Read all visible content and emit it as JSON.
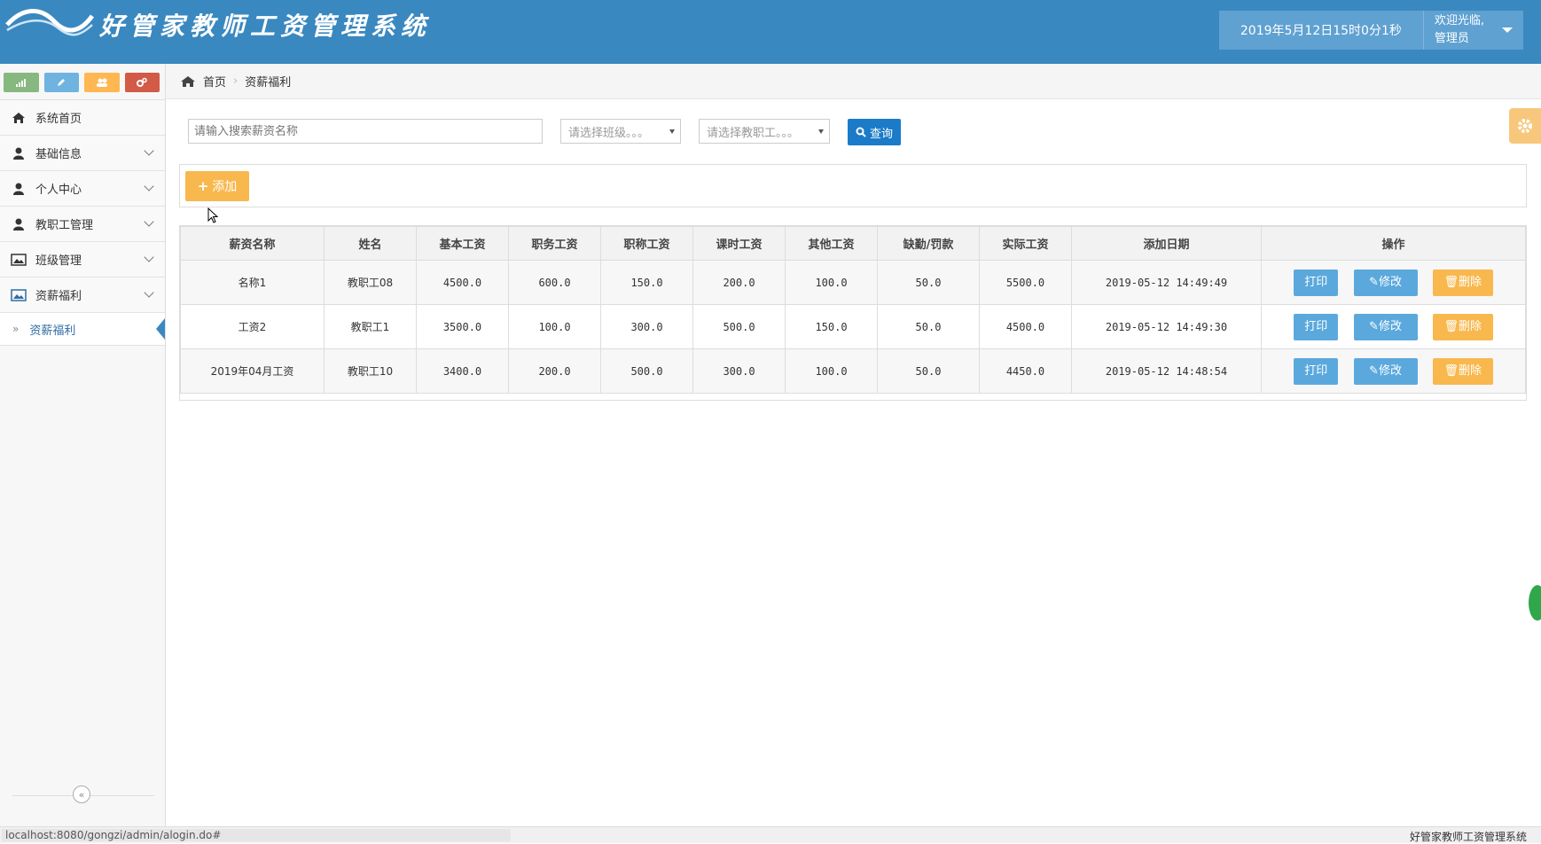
{
  "header": {
    "title": "好管家教师工资管理系统",
    "datetime": "2019年5月12日15时0分1秒",
    "welcome": "欢迎光临,",
    "user": "管理员"
  },
  "sidebar": {
    "items": [
      {
        "label": "系统首页"
      },
      {
        "label": "基础信息"
      },
      {
        "label": "个人中心"
      },
      {
        "label": "教职工管理"
      },
      {
        "label": "班级管理"
      },
      {
        "label": "资薪福利"
      }
    ],
    "sub_item": "资薪福利",
    "collapse_icon": "«"
  },
  "breadcrumb": {
    "home": "首页",
    "current": "资薪福利"
  },
  "search": {
    "placeholder": "请输入搜索薪资名称",
    "class_select": "请选择班级。。。",
    "staff_select": "请选择教职工。。。",
    "query_label": "查询"
  },
  "toolbar": {
    "add_label": "添加"
  },
  "table": {
    "headers": [
      "薪资名称",
      "姓名",
      "基本工资",
      "职务工资",
      "职称工资",
      "课时工资",
      "其他工资",
      "缺勤/罚款",
      "实际工资",
      "添加日期",
      "操作"
    ],
    "rows": [
      [
        "名称1",
        "教职工08",
        "4500.0",
        "600.0",
        "150.0",
        "200.0",
        "100.0",
        "50.0",
        "5500.0",
        "2019-05-12 14:49:49"
      ],
      [
        "工资2",
        "教职工1",
        "3500.0",
        "100.0",
        "300.0",
        "500.0",
        "150.0",
        "50.0",
        "4500.0",
        "2019-05-12 14:49:30"
      ],
      [
        "2019年04月工资",
        "教职工10",
        "3400.0",
        "200.0",
        "500.0",
        "300.0",
        "100.0",
        "50.0",
        "4450.0",
        "2019-05-12 14:48:54"
      ]
    ],
    "actions": {
      "print": "打印",
      "edit": "修改",
      "delete": "删除"
    }
  },
  "footer": {
    "status_url": "localhost:8080/gongzi/admin/alogin.do#",
    "system_name": "好管家教师工资管理系统"
  },
  "colors": {
    "header_bg": "#3a88c0",
    "primary": "#1b7bc8",
    "info": "#5ba8dd",
    "warning": "#f8b84e"
  }
}
